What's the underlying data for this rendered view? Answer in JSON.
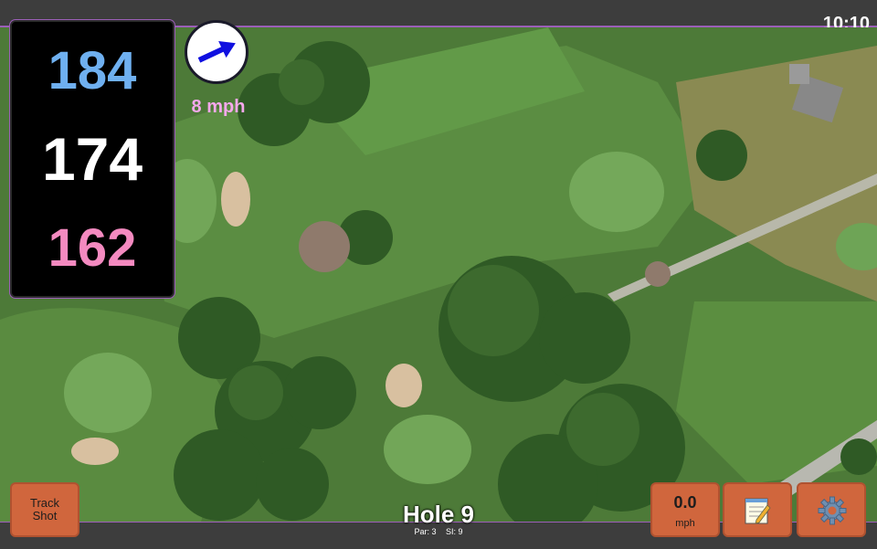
{
  "status": {
    "time": "10:10"
  },
  "distances": {
    "back": "184",
    "middle": "174",
    "front": "162"
  },
  "wind": {
    "speed_label": "8 mph",
    "icon": "wind-direction-arrow-icon",
    "arrow_color": "#1010e0"
  },
  "hole": {
    "title": "Hole 9",
    "par_label": "Par: 3",
    "si_label": "SI: 9"
  },
  "buttons": {
    "track_shot_line1": "Track",
    "track_shot_line2": "Shot",
    "speed_value": "0.0",
    "speed_unit": "mph",
    "notes_icon": "notepad-icon",
    "settings_icon": "gear-icon"
  },
  "colors": {
    "back_distance": "#6fb0f0",
    "middle_distance": "#ffffff",
    "front_distance": "#f48ac0",
    "button_orange": "#d0663d",
    "accent_purple": "#9c5fb8"
  }
}
